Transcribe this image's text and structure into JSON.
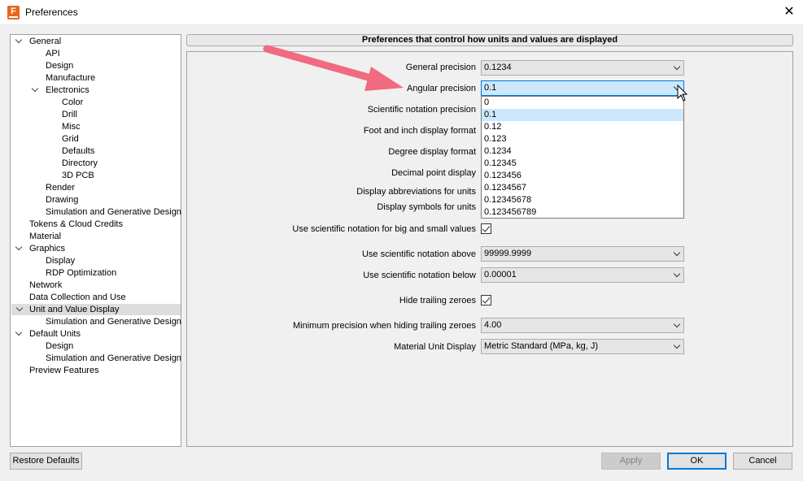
{
  "window": {
    "title": "Preferences",
    "icon_letter": "F"
  },
  "tree": [
    {
      "label": "General",
      "level": 0,
      "expanded": true
    },
    {
      "label": "API",
      "level": 1
    },
    {
      "label": "Design",
      "level": 1
    },
    {
      "label": "Manufacture",
      "level": 1
    },
    {
      "label": "Electronics",
      "level": 1,
      "expanded": true
    },
    {
      "label": "Color",
      "level": 2
    },
    {
      "label": "Drill",
      "level": 2
    },
    {
      "label": "Misc",
      "level": 2
    },
    {
      "label": "Grid",
      "level": 2
    },
    {
      "label": "Defaults",
      "level": 2
    },
    {
      "label": "Directory",
      "level": 2
    },
    {
      "label": "3D PCB",
      "level": 2
    },
    {
      "label": "Render",
      "level": 1
    },
    {
      "label": "Drawing",
      "level": 1
    },
    {
      "label": "Simulation and Generative Design",
      "level": 1
    },
    {
      "label": "Tokens & Cloud Credits",
      "level": 0
    },
    {
      "label": "Material",
      "level": 0
    },
    {
      "label": "Graphics",
      "level": 0,
      "expanded": true
    },
    {
      "label": "Display",
      "level": 1
    },
    {
      "label": "RDP Optimization",
      "level": 1
    },
    {
      "label": "Network",
      "level": 0
    },
    {
      "label": "Data Collection and Use",
      "level": 0
    },
    {
      "label": "Unit and Value Display",
      "level": 0,
      "expanded": true,
      "selected": true
    },
    {
      "label": "Simulation and Generative Design",
      "level": 1
    },
    {
      "label": "Default Units",
      "level": 0,
      "expanded": true
    },
    {
      "label": "Design",
      "level": 1
    },
    {
      "label": "Simulation and Generative Design",
      "level": 1
    },
    {
      "label": "Preview Features",
      "level": 0
    }
  ],
  "main": {
    "header": "Preferences that control how units and values are displayed",
    "general_precision": {
      "label": "General precision",
      "value": "0.1234"
    },
    "angular_precision": {
      "label": "Angular precision",
      "value": "0.1"
    },
    "scientific_notation_precision": {
      "label": "Scientific notation precision"
    },
    "foot_inch_format": {
      "label": "Foot and inch display format"
    },
    "degree_format": {
      "label": "Degree display format"
    },
    "decimal_point": {
      "label": "Decimal point display"
    },
    "display_abbreviations": {
      "label": "Display abbreviations for units"
    },
    "display_symbols": {
      "label": "Display symbols for units"
    },
    "use_sci_big_small": {
      "label": "Use scientific notation for big and small values",
      "checked": true
    },
    "sci_above": {
      "label": "Use scientific notation above",
      "value": "99999.9999"
    },
    "sci_below": {
      "label": "Use scientific notation below",
      "value": "0.00001"
    },
    "hide_trailing": {
      "label": "Hide trailing zeroes",
      "checked": true
    },
    "min_precision": {
      "label": "Minimum precision when hiding trailing zeroes",
      "value": "4.00"
    },
    "material_unit": {
      "label": "Material Unit Display",
      "value": "Metric Standard (MPa, kg, J)"
    },
    "dropdown_options": [
      "0",
      "0.1",
      "0.12",
      "0.123",
      "0.1234",
      "0.12345",
      "0.123456",
      "0.1234567",
      "0.12345678",
      "0.123456789"
    ],
    "dropdown_selected": "0.1"
  },
  "buttons": {
    "restore": "Restore Defaults",
    "apply": "Apply",
    "ok": "OK",
    "cancel": "Cancel"
  },
  "colors": {
    "accent": "#0078d7",
    "highlight": "#cce8ff",
    "annotation_arrow": "#f06a80",
    "app_icon": "#e8671c"
  }
}
